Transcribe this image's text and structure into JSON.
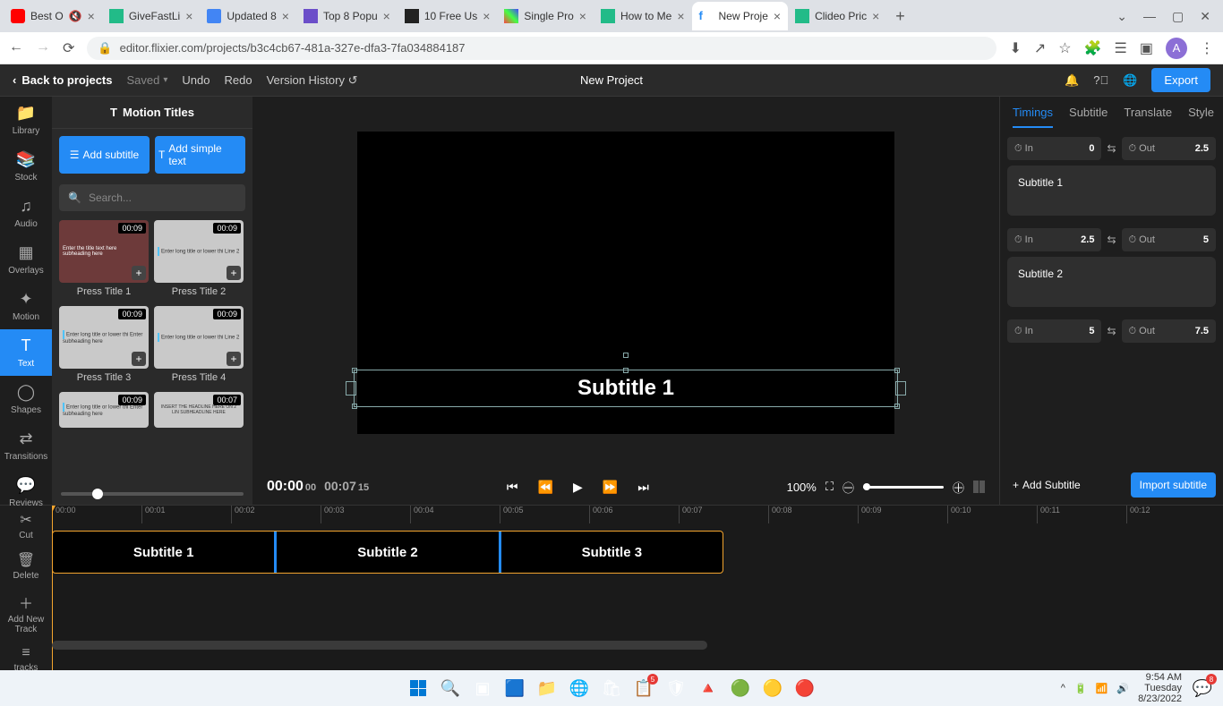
{
  "browser": {
    "tabs": [
      {
        "title": "Best O",
        "muted": true
      },
      {
        "title": "GiveFastLi"
      },
      {
        "title": "Updated 8"
      },
      {
        "title": "Top 8 Popu"
      },
      {
        "title": "10 Free Us"
      },
      {
        "title": "Single Pro"
      },
      {
        "title": "How to Me"
      },
      {
        "title": "New Proje",
        "active": true
      },
      {
        "title": "Clideo Pric"
      }
    ],
    "url": "editor.flixier.com/projects/b3c4cb67-481a-327e-dfa3-7fa034884187",
    "avatar_letter": "A"
  },
  "appbar": {
    "back": "Back to projects",
    "saved": "Saved",
    "undo": "Undo",
    "redo": "Redo",
    "version_history": "Version History",
    "project_name": "New Project",
    "export": "Export"
  },
  "sidebar": {
    "items": [
      {
        "label": "Library"
      },
      {
        "label": "Stock"
      },
      {
        "label": "Audio"
      },
      {
        "label": "Overlays"
      },
      {
        "label": "Motion"
      },
      {
        "label": "Text",
        "active": true
      },
      {
        "label": "Shapes"
      },
      {
        "label": "Transitions"
      },
      {
        "label": "Reviews"
      }
    ]
  },
  "panel": {
    "title": "Motion Titles",
    "add_subtitle": "Add subtitle",
    "add_simple_text": "Add simple text",
    "search_placeholder": "Search...",
    "templates": [
      {
        "name": "Press Title 1",
        "duration": "00:09",
        "bg": "#6d3a3a",
        "text": "Enter the title text here subheading here"
      },
      {
        "name": "Press Title 2",
        "duration": "00:09",
        "bg": "#c9c9c9",
        "text": "Enter long title or lower thi Line 2"
      },
      {
        "name": "Press Title 3",
        "duration": "00:09",
        "bg": "#c9c9c9",
        "text": "Enter long title or lower thi Enter subheading here"
      },
      {
        "name": "Press Title 4",
        "duration": "00:09",
        "bg": "#c9c9c9",
        "text": "Enter long title or lower thi Line 2"
      },
      {
        "name": "",
        "duration": "00:09",
        "bg": "#c9c9c9",
        "text": "Enter long title or lower thi Enter subheading here"
      },
      {
        "name": "",
        "duration": "00:07",
        "bg": "#c9c9c9",
        "text": "INSERT THE HEADLINE HERE ON 2 LIN SUBHEADLINE HERE"
      }
    ]
  },
  "preview": {
    "subtitle_text": "Subtitle 1",
    "current_time": "00:00",
    "current_frames": "00",
    "total_time": "00:07",
    "total_frames": "15",
    "zoom": "100%"
  },
  "right_panel": {
    "tabs": [
      "Timings",
      "Subtitle",
      "Translate",
      "Style"
    ],
    "active_tab": "Timings",
    "subtitles": [
      {
        "in_label": "In",
        "in": "0",
        "out_label": "Out",
        "out": "2.5",
        "text": "Subtitle 1"
      },
      {
        "in_label": "In",
        "in": "2.5",
        "out_label": "Out",
        "out": "5",
        "text": "Subtitle 2"
      },
      {
        "in_label": "In",
        "in": "5",
        "out_label": "Out",
        "out": "7.5",
        "text": ""
      }
    ],
    "add_subtitle": "Add Subtitle",
    "import_subtitle": "Import subtitle"
  },
  "timeline": {
    "tools": [
      {
        "label": "Cut"
      },
      {
        "label": "Delete"
      },
      {
        "label": "Add New Track"
      },
      {
        "label": "tracks"
      }
    ],
    "ruler": [
      "00:00",
      "00:01",
      "00:02",
      "00:03",
      "00:04",
      "00:05",
      "00:06",
      "00:07",
      "00:08",
      "00:09",
      "00:10",
      "00:11",
      "00:12"
    ],
    "subtitle_clips": [
      "Subtitle 1",
      "Subtitle 2",
      "Subtitle 3"
    ]
  },
  "taskbar": {
    "time": "9:54 AM",
    "day": "Tuesday",
    "date": "8/23/2022",
    "notif": "8"
  }
}
